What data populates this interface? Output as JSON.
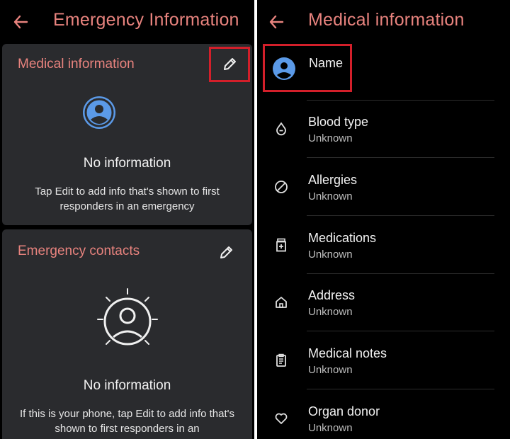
{
  "left_screen": {
    "title": "Emergency Information",
    "medical_card": {
      "title": "Medical information",
      "empty_title": "No information",
      "empty_message": "Tap Edit to add info that's shown to first responders in an emergency"
    },
    "contacts_card": {
      "title": "Emergency contacts",
      "empty_title": "No information",
      "empty_message": "If this is your phone, tap Edit to add info that's shown to first responders in an"
    }
  },
  "right_screen": {
    "title": "Medical information",
    "name_label": "Name",
    "fields": [
      {
        "label": "Blood type",
        "value": "Unknown",
        "icon": "blood-drop-icon"
      },
      {
        "label": "Allergies",
        "value": "Unknown",
        "icon": "no-symbol-icon"
      },
      {
        "label": "Medications",
        "value": "Unknown",
        "icon": "medication-bottle-icon"
      },
      {
        "label": "Address",
        "value": "Unknown",
        "icon": "home-icon"
      },
      {
        "label": "Medical notes",
        "value": "Unknown",
        "icon": "clipboard-icon"
      },
      {
        "label": "Organ donor",
        "value": "Unknown",
        "icon": "heart-icon"
      }
    ]
  },
  "colors": {
    "accent": "#e8837e",
    "highlight": "#d31f2a",
    "avatar_blue": "#5b9ae8",
    "card_background": "#2a2b2e",
    "screen_background": "#000000"
  }
}
